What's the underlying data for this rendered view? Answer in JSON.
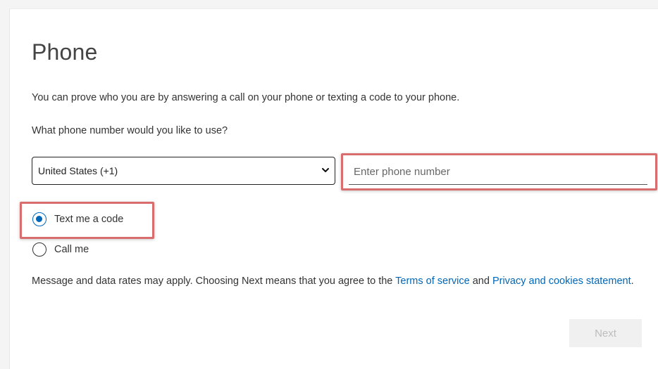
{
  "page": {
    "title": "Phone",
    "intro": "You can prove who you are by answering a call on your phone or texting a code to your phone.",
    "question": "What phone number would you like to use?"
  },
  "country_select": {
    "selected": "United States (+1)"
  },
  "phone_input": {
    "placeholder": "Enter phone number",
    "value": ""
  },
  "method_options": [
    {
      "label": "Text me a code",
      "selected": true
    },
    {
      "label": "Call me",
      "selected": false
    }
  ],
  "disclaimer": {
    "prefix": "Message and data rates may apply. Choosing Next means that you agree to the ",
    "terms_link": "Terms of service",
    "middle": " and ",
    "privacy_link": "Privacy and cookies statement",
    "suffix": "."
  },
  "actions": {
    "next_label": "Next",
    "next_disabled": true
  },
  "colors": {
    "accent": "#0067b8",
    "highlight": "#d96c6c"
  },
  "icons": {
    "select_chevron": "chevron-down-icon"
  }
}
